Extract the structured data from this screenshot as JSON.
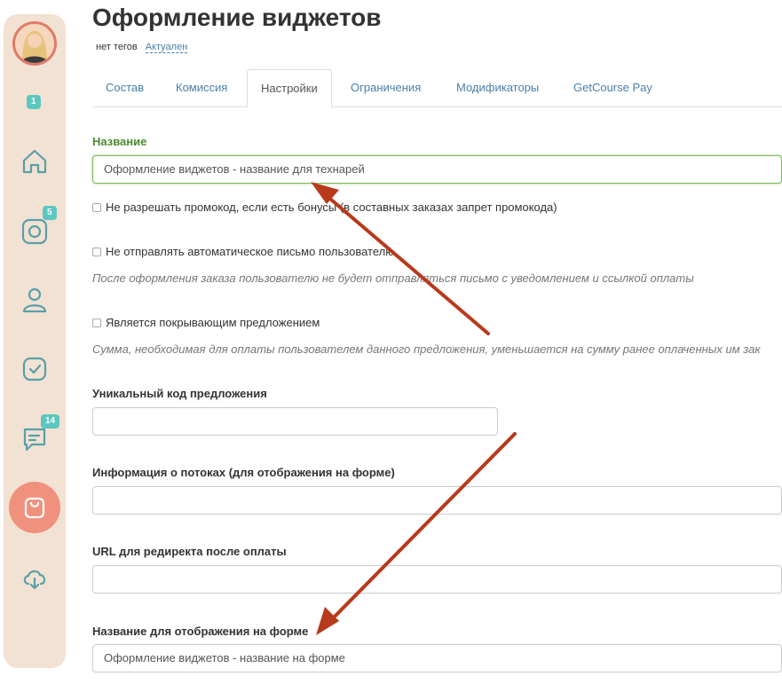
{
  "page": {
    "title": "Оформление виджетов",
    "tags_text": "нет тегов",
    "status": "Актуален"
  },
  "sidebar": {
    "badges": {
      "top": "1",
      "instagram": "5",
      "chat": "14"
    },
    "icons": [
      "home-icon",
      "instagram-icon",
      "user-icon",
      "check-icon",
      "chat-icon",
      "shopping-bag-icon",
      "cloud-download-icon"
    ]
  },
  "tabs": [
    {
      "label": "Состав"
    },
    {
      "label": "Комиссия"
    },
    {
      "label": "Настройки",
      "active": true
    },
    {
      "label": "Ограничения"
    },
    {
      "label": "Модификаторы"
    },
    {
      "label": "GetCourse Pay"
    }
  ],
  "form": {
    "name_label": "Название",
    "name_value": "Оформление виджетов - название для технарей",
    "no_promo_label": "Не разрешать промокод, если есть бонусы (в составных заказах запрет промокода)",
    "no_email_label": "Не отправлять автоматическое письмо пользователю",
    "no_email_hint": "После оформления заказа пользователю не будет отправляться письмо с уведомлением и ссылкой оплаты",
    "covering_label": "Является покрывающим предложением",
    "covering_hint": "Сумма, необходимая для оплаты пользователем данного предложения, уменьшается на сумму ранее оплаченных им зак",
    "unique_code_label": "Уникальный код предложения",
    "unique_code_value": "",
    "streams_label": "Информация о потоках (для отображения на форме)",
    "streams_value": "",
    "redirect_label": "URL для редиректа после оплаты",
    "redirect_value": "",
    "form_name_label": "Название для отображения на форме",
    "form_name_value": "Оформление виджетов - название на форме"
  },
  "colors": {
    "accent": "#4a7fa8",
    "sidebar_bg": "#f2e2d3",
    "active_nav": "#f0917e",
    "badge": "#5cc7c0",
    "arrow": "#b8391b",
    "label_green": "#4a8a2e"
  }
}
